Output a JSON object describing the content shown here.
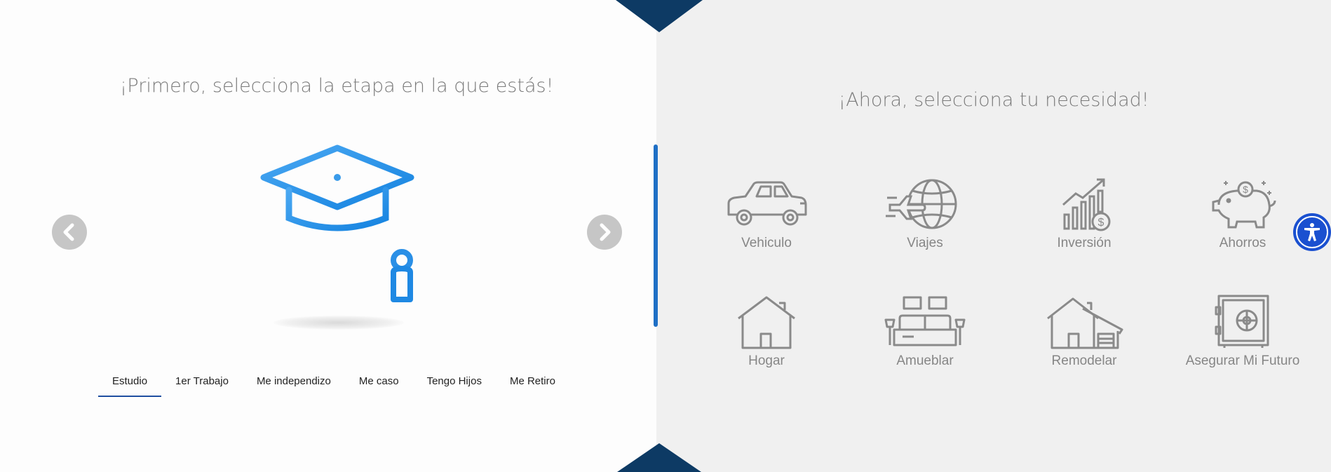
{
  "colors": {
    "accent_dark": "#0d3a64",
    "accent_blue": "#1e6fc5",
    "cap_gradient_start": "#4aa8f2",
    "cap_gradient_end": "#1583e0",
    "icon_gray": "#8a8a8a",
    "right_panel_bg": "#f0f0f0"
  },
  "left": {
    "title": "¡Primero, selecciona la etapa en la que estás!",
    "hero_icon": "graduation-cap-icon",
    "prev_icon": "chevron-left-icon",
    "next_icon": "chevron-right-icon",
    "tabs": [
      {
        "label": "Estudio",
        "active": true
      },
      {
        "label": "1er Trabajo",
        "active": false
      },
      {
        "label": "Me independizo",
        "active": false
      },
      {
        "label": "Me caso",
        "active": false
      },
      {
        "label": "Tengo Hijos",
        "active": false
      },
      {
        "label": "Me Retiro",
        "active": false
      }
    ]
  },
  "right": {
    "title": "¡Ahora, selecciona tu necesidad!",
    "needs": [
      {
        "label": "Vehiculo",
        "icon": "car-icon"
      },
      {
        "label": "Viajes",
        "icon": "airplane-globe-icon"
      },
      {
        "label": "Inversión",
        "icon": "growth-chart-icon"
      },
      {
        "label": "Ahorros",
        "icon": "piggy-bank-icon"
      },
      {
        "label": "Hogar",
        "icon": "house-icon"
      },
      {
        "label": "Amueblar",
        "icon": "furniture-icon"
      },
      {
        "label": "Remodelar",
        "icon": "house-garage-icon"
      },
      {
        "label": "Asegurar Mi Futuro",
        "icon": "safe-icon"
      }
    ]
  },
  "accessibility": {
    "icon": "accessibility-icon"
  }
}
